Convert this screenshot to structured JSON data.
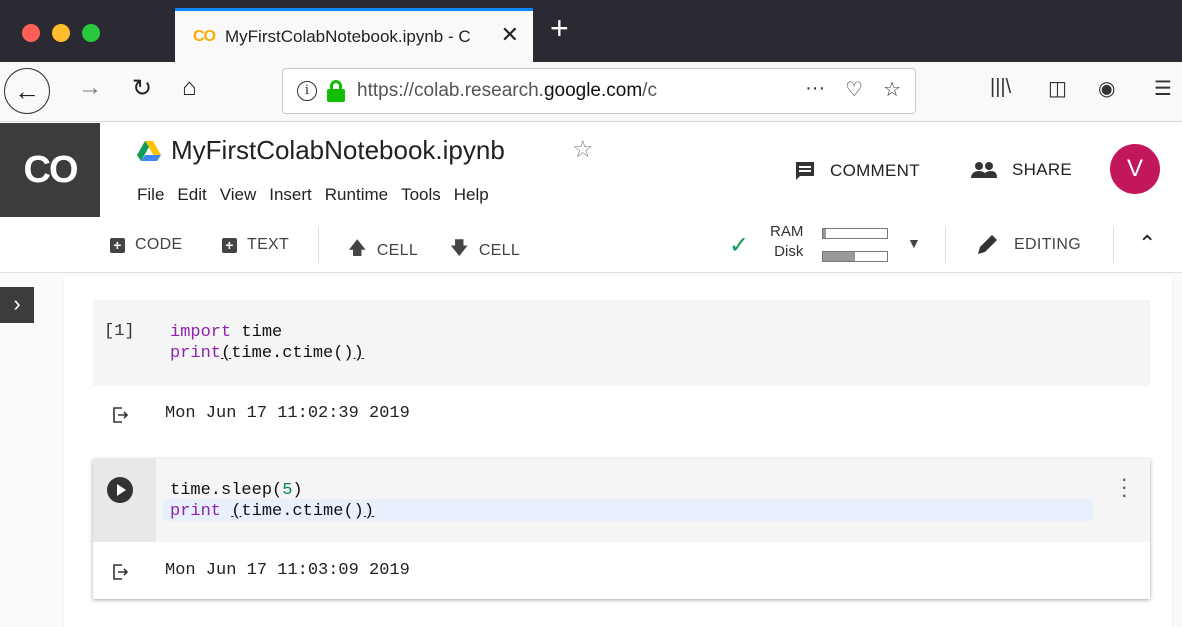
{
  "browser": {
    "tab_favicon": "CO",
    "tab_title": "MyFirstColabNotebook.ipynb - C",
    "tab_close": "✕",
    "new_tab": "+",
    "url_prefix": "https://colab.research.",
    "url_domain": "google.com",
    "url_suffix": "/c",
    "icons": [
      "back-icon",
      "forward-icon",
      "reload-icon",
      "home-icon",
      "info-icon",
      "lock-icon",
      "more-icon",
      "pocket-icon",
      "bookmark-star-icon",
      "library-icon",
      "sidebar-icon",
      "account-icon",
      "menu-icon"
    ]
  },
  "header": {
    "logo": "CO",
    "title": "MyFirstColabNotebook.ipynb",
    "menu": [
      "File",
      "Edit",
      "View",
      "Insert",
      "Runtime",
      "Tools",
      "Help"
    ],
    "comment_label": "COMMENT",
    "share_label": "SHARE",
    "avatar_initial": "V",
    "avatar_color": "#c2185b"
  },
  "toolbar": {
    "code_label": "CODE",
    "text_label": "TEXT",
    "cell_up_label": "CELL",
    "cell_down_label": "CELL",
    "ram_label": "RAM",
    "disk_label": "Disk",
    "ram_usage": 0.05,
    "disk_usage": 0.5,
    "editing_label": "EDITING",
    "status_color": "#0f9d58"
  },
  "cells": [
    {
      "prompt": "[1]",
      "line1_kw": "import",
      "line1_rest": " time",
      "line2_kw": "print",
      "line2_open": "(",
      "line2_mid": "time.ctime()",
      "line2_close": ")",
      "output": "Mon Jun 17 11:02:39 2019"
    },
    {
      "line1_pre": "time.sleep(",
      "line1_num": "5",
      "line1_post": ")",
      "line2_kw": "print",
      "line2_space": " ",
      "line2_open": "(",
      "line2_mid": "time.ctime()",
      "line2_close": ")",
      "output": "Mon Jun 17 11:03:09 2019"
    }
  ]
}
